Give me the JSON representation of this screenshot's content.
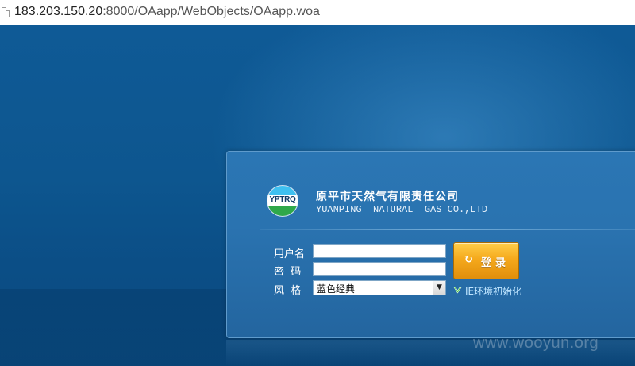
{
  "browser": {
    "url_host": "183.203.150.20",
    "url_rest": ":8000/OAapp/WebObjects/OAapp.woa"
  },
  "login": {
    "logo_text": "YPTRQ",
    "company_cn": "原平市天然气有限责任公司",
    "company_en": "YUANPING  NATURAL  GAS CO.,LTD",
    "username_label": "用户名",
    "password_label": "密  码",
    "style_label": "风  格",
    "username_value": "",
    "password_value": "",
    "style_selected": "蓝色经典",
    "login_button_label": "登录",
    "ie_init_link": "IE环境初始化"
  },
  "watermark": "www.wooyun.org",
  "colors": {
    "background": "#0d568f",
    "panel": "#2a73b0",
    "button": "#f5a91c"
  },
  "icons": {
    "page": "page-icon",
    "login": "arrow-circle-icon",
    "ie": "green-check-icon",
    "select": "chevron-down-icon"
  }
}
